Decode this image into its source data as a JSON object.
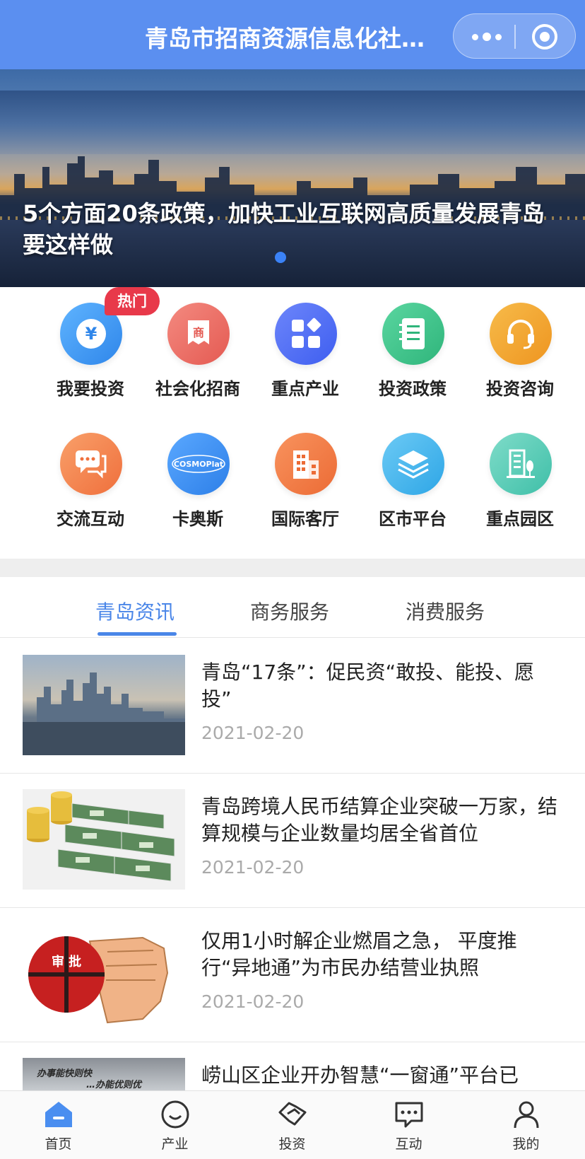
{
  "header": {
    "title": "青岛市招商资源信息化社…"
  },
  "banner": {
    "title": "5个方面20条政策，加快工业互联网高质量发展青岛要这样做"
  },
  "grid": {
    "hot_badge": "热门",
    "items": [
      {
        "label": "我要投资",
        "icon": "yuan-icon",
        "color": "#3d9bf0"
      },
      {
        "label": "社会化招商",
        "icon": "shang-tag-icon",
        "color": "#ec6a63"
      },
      {
        "label": "重点产业",
        "icon": "apps-grid-icon",
        "color": "#4e6ef2"
      },
      {
        "label": "投资政策",
        "icon": "document-icon",
        "color": "#3fc18a"
      },
      {
        "label": "投资咨询",
        "icon": "headset-icon",
        "color": "#f2a534"
      },
      {
        "label": "交流互动",
        "icon": "chat-bubbles-icon",
        "color": "#f2844d"
      },
      {
        "label": "卡奥斯",
        "icon": "cosmoplat-logo",
        "color": "#3d8ff0",
        "logo_text": "COSMOPlat"
      },
      {
        "label": "国际客厅",
        "icon": "building-icon",
        "color": "#f07a44"
      },
      {
        "label": "区市平台",
        "icon": "layers-icon",
        "color": "#44b6ec"
      },
      {
        "label": "重点园区",
        "icon": "park-building-icon",
        "color": "#4fcfbb"
      }
    ]
  },
  "tabs": [
    {
      "label": "青岛资讯",
      "active": true
    },
    {
      "label": "商务服务",
      "active": false
    },
    {
      "label": "消费服务",
      "active": false
    }
  ],
  "news": [
    {
      "title": "青岛“17条”：促民资“敢投、能投、愿投”",
      "date": "2021-02-20",
      "thumb": "city-skyline"
    },
    {
      "title": "青岛跨境人民币结算企业突破一万家，结算规模与企业数量均居全省首位",
      "date": "2021-02-20",
      "thumb": "money-stacks"
    },
    {
      "title": "仅用1小时解企业燃眉之急， 平度推行“异地通”为市民办结营业执照",
      "date": "2021-02-20",
      "thumb": "approval-fist",
      "thumb_text": "审 批"
    },
    {
      "title": "崂山区企业开办智慧“一窗通”平台已",
      "date": "",
      "thumb": "office-wall",
      "thumb_text_1": "办事能快则快",
      "thumb_text_2": "…办能优则优"
    }
  ],
  "tabbar": [
    {
      "label": "首页",
      "icon": "home-icon",
      "active": true
    },
    {
      "label": "产业",
      "icon": "smile-icon",
      "active": false
    },
    {
      "label": "投资",
      "icon": "handshake-icon",
      "active": false
    },
    {
      "label": "互动",
      "icon": "chat-icon",
      "active": false
    },
    {
      "label": "我的",
      "icon": "user-icon",
      "active": false
    }
  ],
  "colors": {
    "header_bg": "#5b8ff0",
    "accent": "#4a86e8",
    "hot": "#e8394a"
  }
}
